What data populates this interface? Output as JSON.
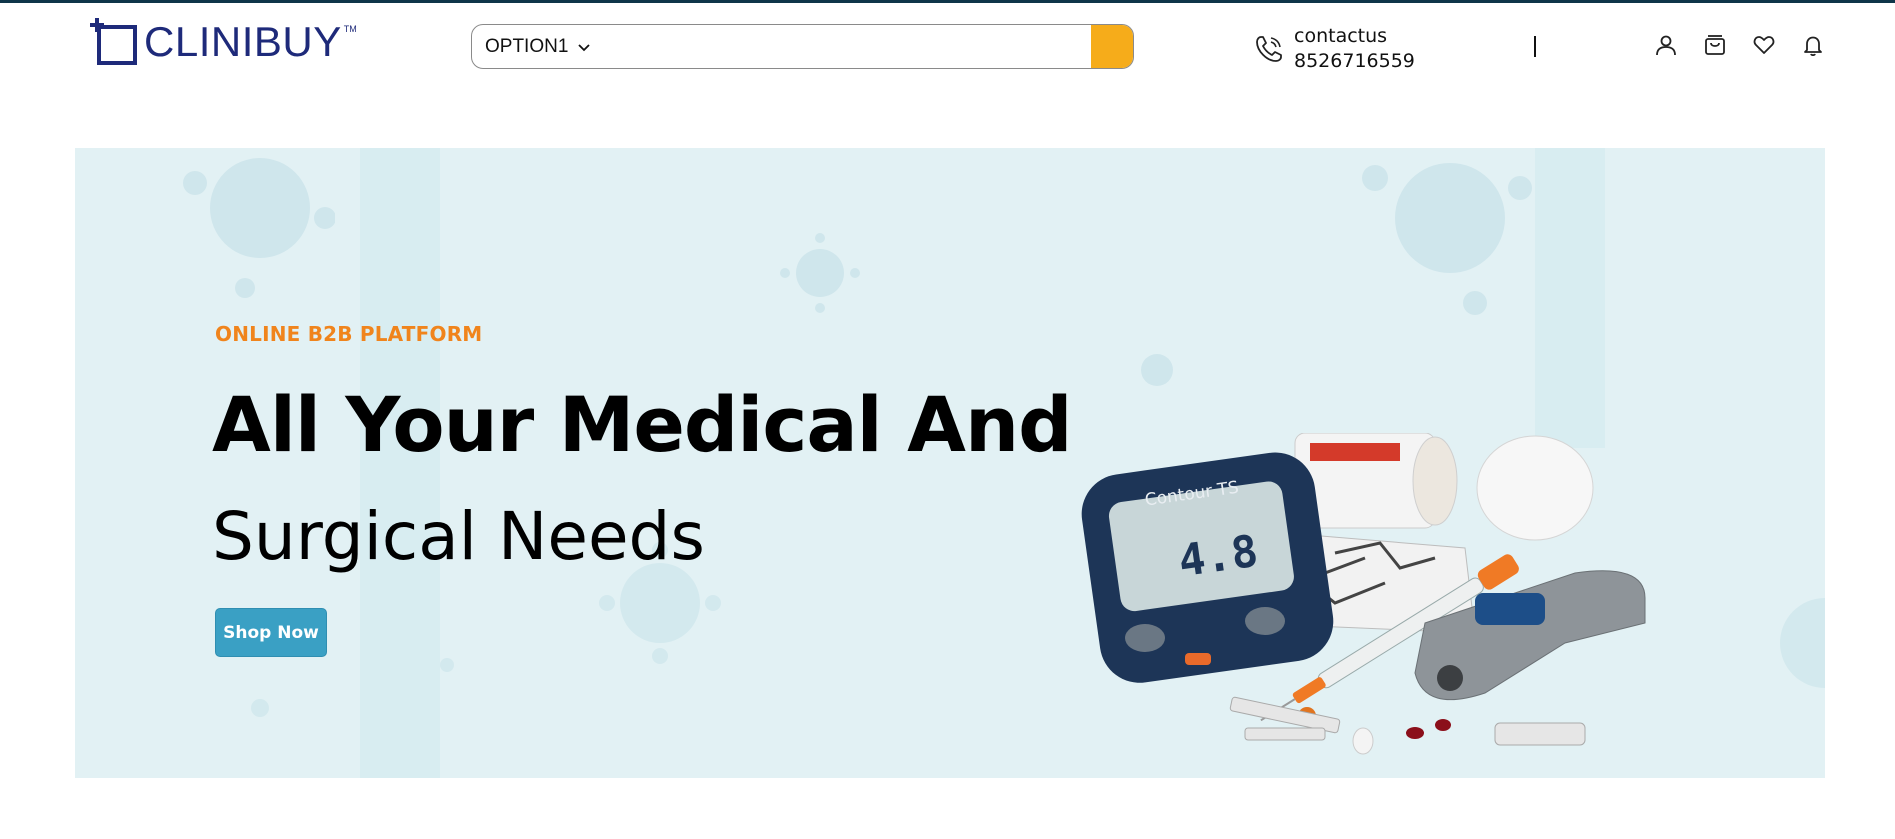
{
  "header": {
    "logo_text": "CLINIBUY",
    "logo_tm": "TM",
    "search": {
      "category_selected": "OPTION1",
      "input_value": "",
      "button_icon": "search-icon"
    },
    "contact": {
      "icon": "phone-icon",
      "line1": "contactus",
      "line2": "8526716559"
    },
    "icons": [
      "user-icon",
      "cart-icon",
      "heart-icon",
      "bell-icon"
    ]
  },
  "hero": {
    "eyebrow": "ONLINE B2B PLATFORM",
    "headline_line1": "All Your Medical And",
    "headline_line2": "Surgical Needs",
    "cta_label": "Shop Now"
  },
  "colors": {
    "top_bar": "#0f3549",
    "brand": "#1e2a7a",
    "search_button": "#f6ac1a",
    "hero_bg": "#e2f1f4",
    "eyebrow": "#f0841c",
    "cta": "#3aa0c4"
  }
}
